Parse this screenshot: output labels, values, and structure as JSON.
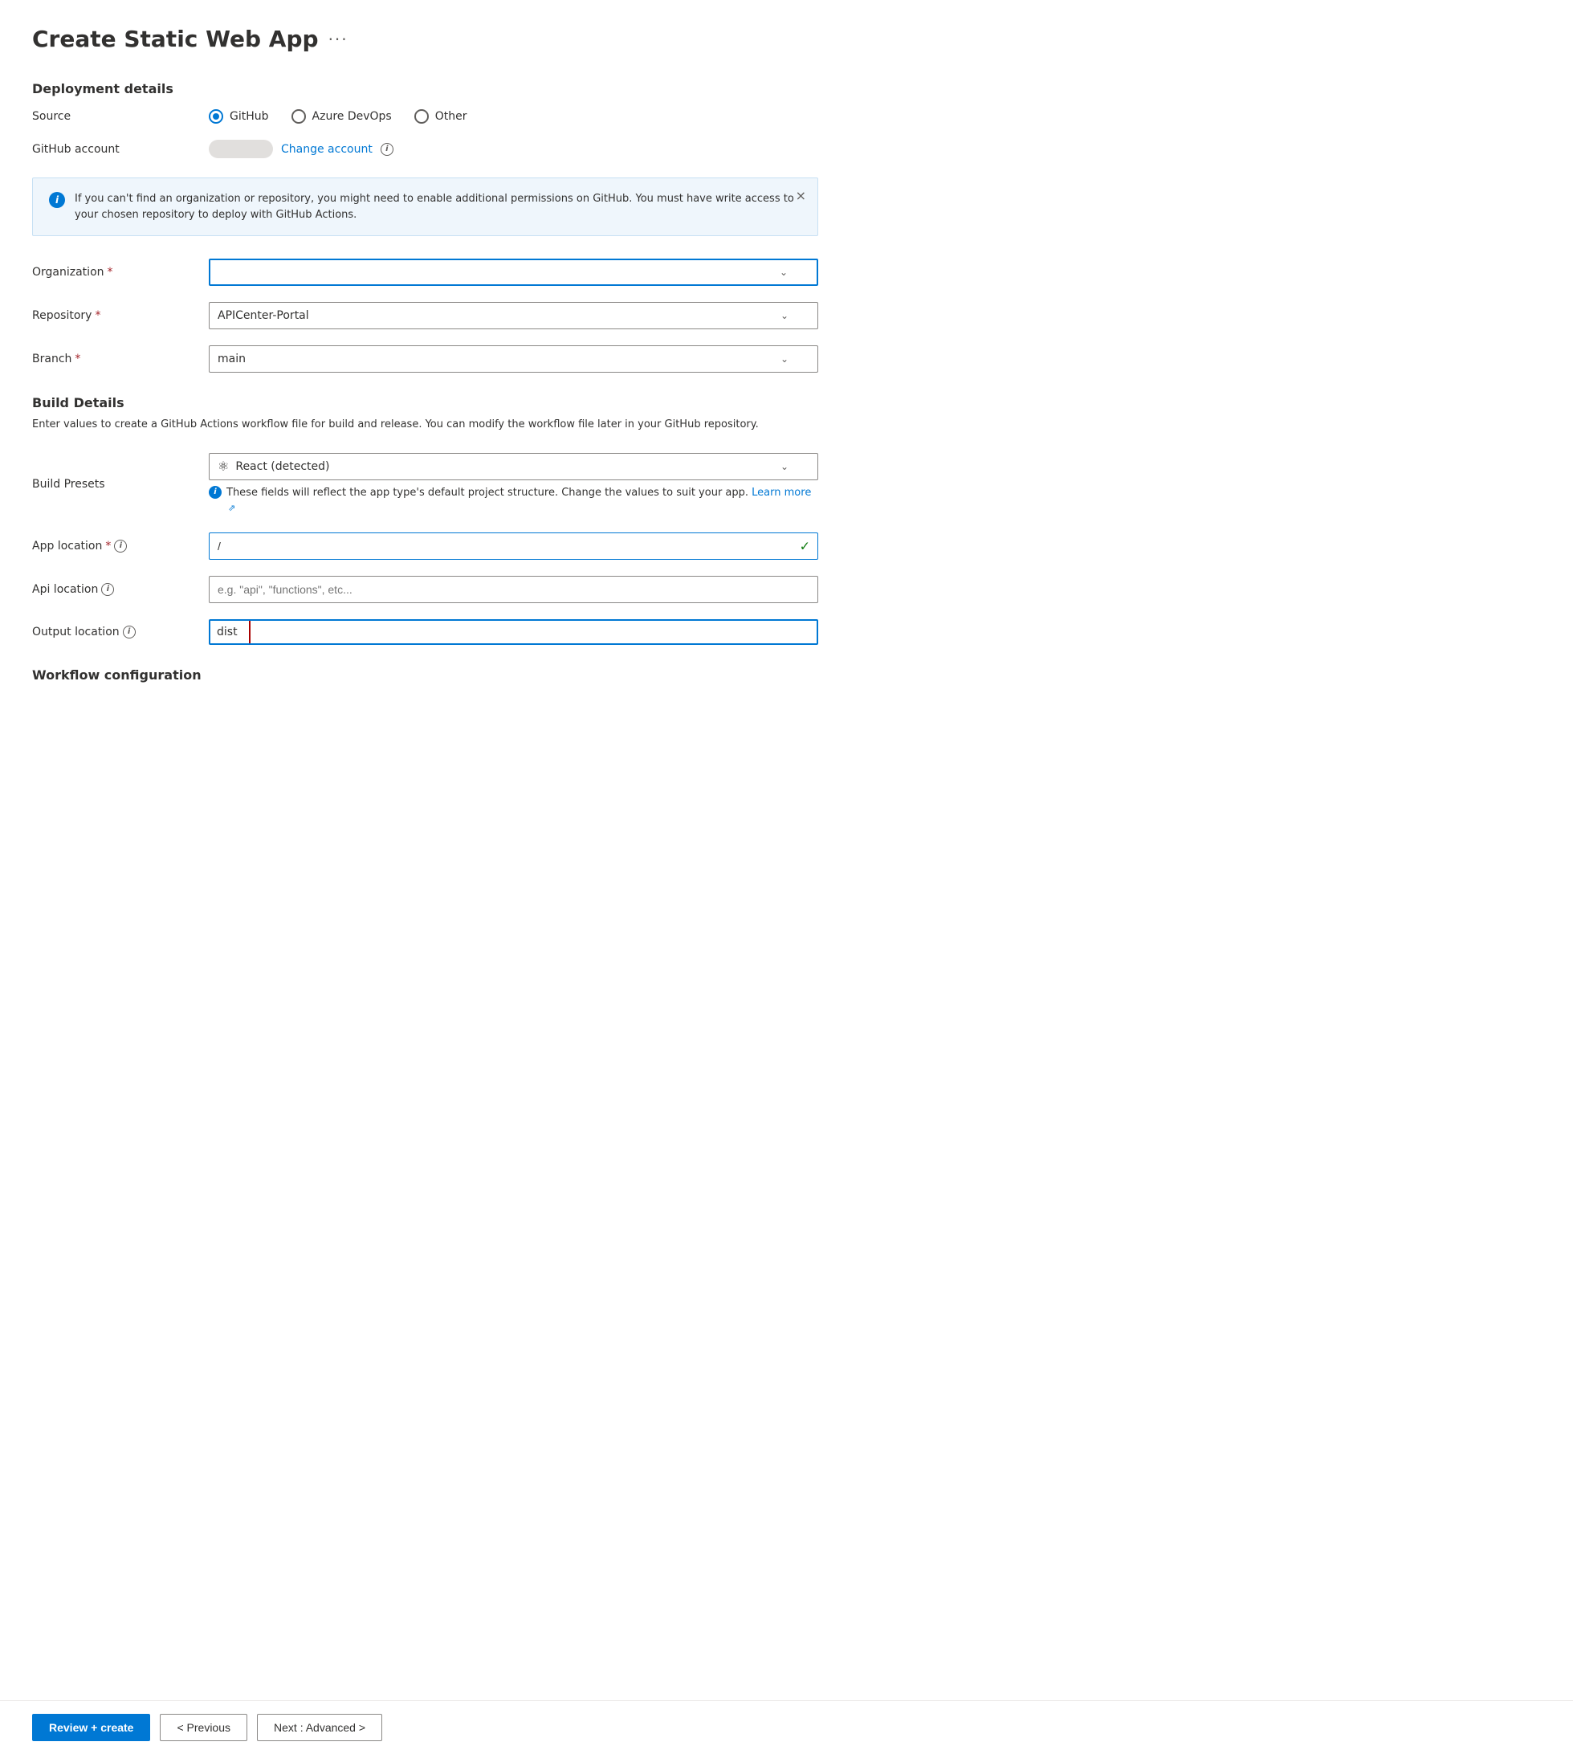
{
  "page": {
    "title": "Create Static Web App",
    "more_icon": "···"
  },
  "deployment": {
    "section_title": "Deployment details",
    "source_label": "Source",
    "source_options": [
      {
        "id": "github",
        "label": "GitHub",
        "selected": true
      },
      {
        "id": "azure_devops",
        "label": "Azure DevOps",
        "selected": false
      },
      {
        "id": "other",
        "label": "Other",
        "selected": false
      }
    ],
    "github_account_label": "GitHub account",
    "github_account_value": "",
    "change_account_label": "Change account"
  },
  "info_banner": {
    "text": "If you can't find an organization or repository, you might need to enable additional permissions on GitHub. You must have write access to your chosen repository to deploy with GitHub Actions."
  },
  "form_fields": {
    "organization_label": "Organization",
    "organization_placeholder": "",
    "organization_value": "",
    "repository_label": "Repository",
    "repository_value": "APICenter-Portal",
    "branch_label": "Branch",
    "branch_value": "main"
  },
  "build": {
    "section_title": "Build Details",
    "description": "Enter values to create a GitHub Actions workflow file for build and release. You can modify the workflow file later in your GitHub repository.",
    "presets_label": "Build Presets",
    "presets_value": "React (detected)",
    "presets_icon": "⚛",
    "fields_note": "These fields will reflect the app type's default project structure. Change the values to suit your app.",
    "learn_more": "Learn more",
    "app_location_label": "App location",
    "app_location_value": "/",
    "api_location_label": "Api location",
    "api_location_placeholder": "e.g. \"api\", \"functions\", etc...",
    "output_location_label": "Output location",
    "output_location_value": "dist"
  },
  "workflow": {
    "section_title": "Workflow configuration"
  },
  "footer": {
    "review_create_label": "Review + create",
    "previous_label": "< Previous",
    "next_label": "Next : Advanced >"
  }
}
